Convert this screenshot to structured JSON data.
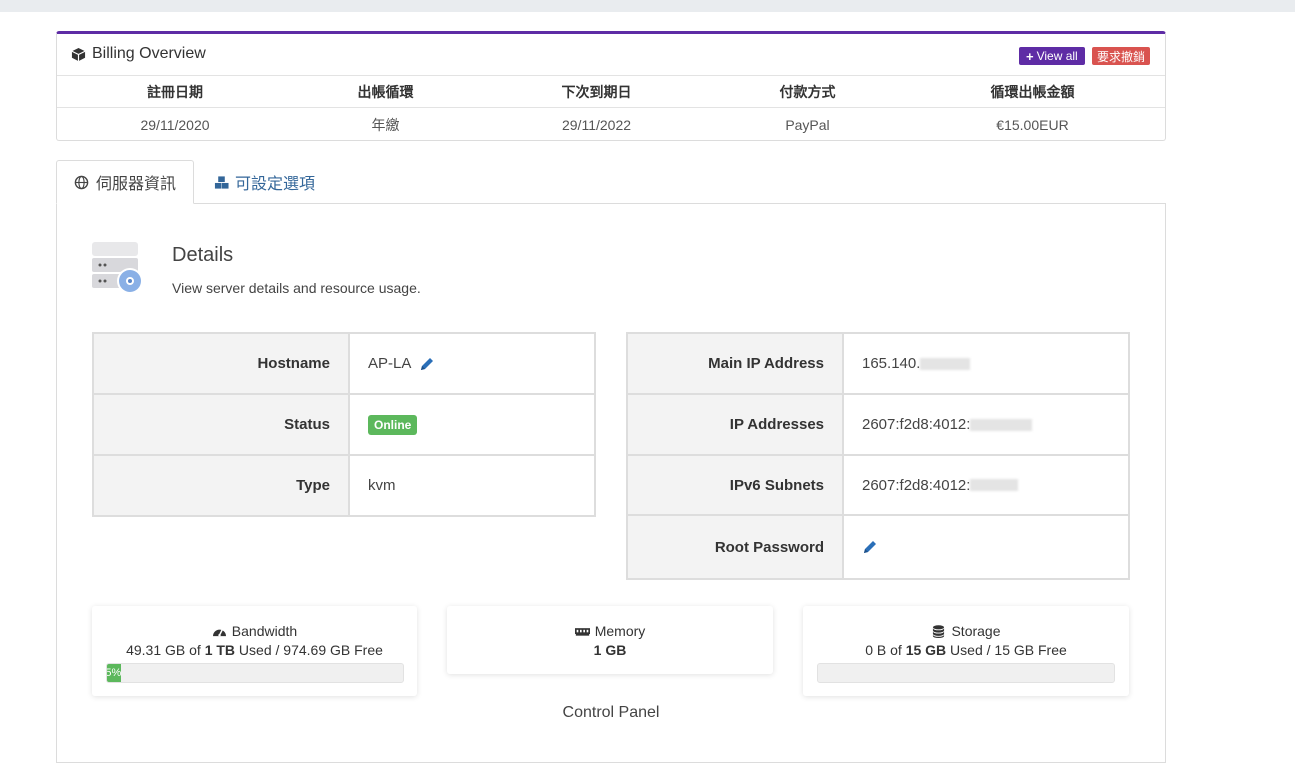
{
  "billing": {
    "title": "Billing Overview",
    "view_all": "View all",
    "cancel": "要求撤銷",
    "columns": [
      "註冊日期",
      "出帳循環",
      "下次到期日",
      "付款方式",
      "循環出帳金額"
    ],
    "values": [
      "29/11/2020",
      "年繳",
      "29/11/2022",
      "PayPal",
      "€15.00EUR"
    ]
  },
  "tabs": [
    {
      "label": "伺服器資訊",
      "icon": "globe-icon",
      "active": true
    },
    {
      "label": "可設定選項",
      "icon": "cubes-icon",
      "active": false
    }
  ],
  "details": {
    "title": "Details",
    "subtitle": "View server details and resource usage."
  },
  "server_info": {
    "hostname_label": "Hostname",
    "hostname": "AP-LA",
    "status_label": "Status",
    "status": "Online",
    "type_label": "Type",
    "type": "kvm"
  },
  "network_info": {
    "main_ip_label": "Main IP Address",
    "main_ip": "165.140.",
    "ip_addresses_label": "IP Addresses",
    "ip_addresses": "2607:f2d8:4012:",
    "ipv6_label": "IPv6 Subnets",
    "ipv6": "2607:f2d8:4012:",
    "root_password_label": "Root Password"
  },
  "resources": {
    "bandwidth": {
      "title": "Bandwidth",
      "used": "49.31 GB",
      "of": " of ",
      "total": "1 TB",
      "suffix": " Used / 974.69 GB Free",
      "bar_label": "5%",
      "percent": 5
    },
    "memory": {
      "title": "Memory",
      "value": "1 GB"
    },
    "storage": {
      "title": "Storage",
      "used": "0 B",
      "of": " of ",
      "total": "15 GB",
      "suffix": " Used / 15 GB Free",
      "percent": 0
    }
  },
  "control_panel": {
    "title": "Control Panel"
  },
  "colors": {
    "accent": "#5e2ca5",
    "danger": "#d9534f",
    "success": "#5cb85c",
    "link": "#336699"
  }
}
